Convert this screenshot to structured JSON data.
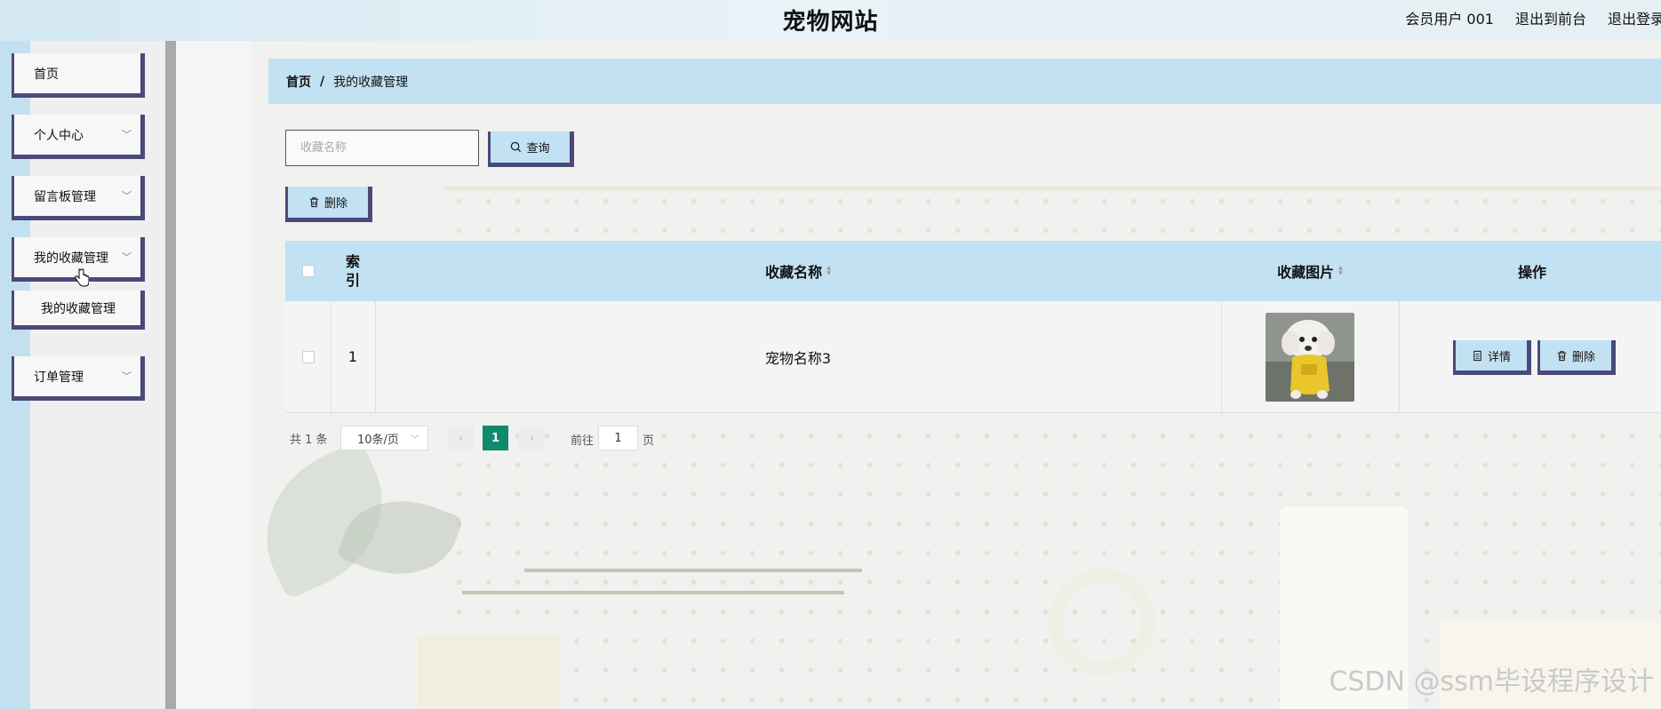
{
  "header": {
    "site_title": "宠物网站",
    "user_label": "会员用户 001",
    "frontend_link": "退出到前台",
    "logout_link": "退出登录"
  },
  "sidebar": {
    "items": [
      {
        "label": "首页"
      },
      {
        "label": "个人中心"
      },
      {
        "label": "留言板管理"
      },
      {
        "label": "我的收藏管理"
      },
      {
        "label": "订单管理"
      }
    ],
    "submenu": {
      "label": "我的收藏管理"
    }
  },
  "breadcrumb": {
    "home": "首页",
    "separator": "/",
    "current": "我的收藏管理"
  },
  "search": {
    "placeholder": "收藏名称",
    "value": "",
    "button_label": "查询"
  },
  "toolbar": {
    "delete_label": "删除"
  },
  "table": {
    "columns": {
      "index": "索引",
      "name": "收藏名称",
      "image": "收藏图片",
      "actions": "操作"
    },
    "rows": [
      {
        "index": "1",
        "name": "宠物名称3",
        "detail_label": "详情",
        "delete_label": "删除"
      }
    ]
  },
  "pagination": {
    "total_text": "共 1 条",
    "page_size": "10条/页",
    "current_page": "1",
    "goto_label": "前往",
    "goto_value": "1",
    "goto_suffix": "页"
  },
  "watermark": "CSDN @ssm毕设程序设计",
  "colors": {
    "accent": "#c2e1f2",
    "border": "#4a4a7a",
    "active_page": "#0f8a6d"
  }
}
